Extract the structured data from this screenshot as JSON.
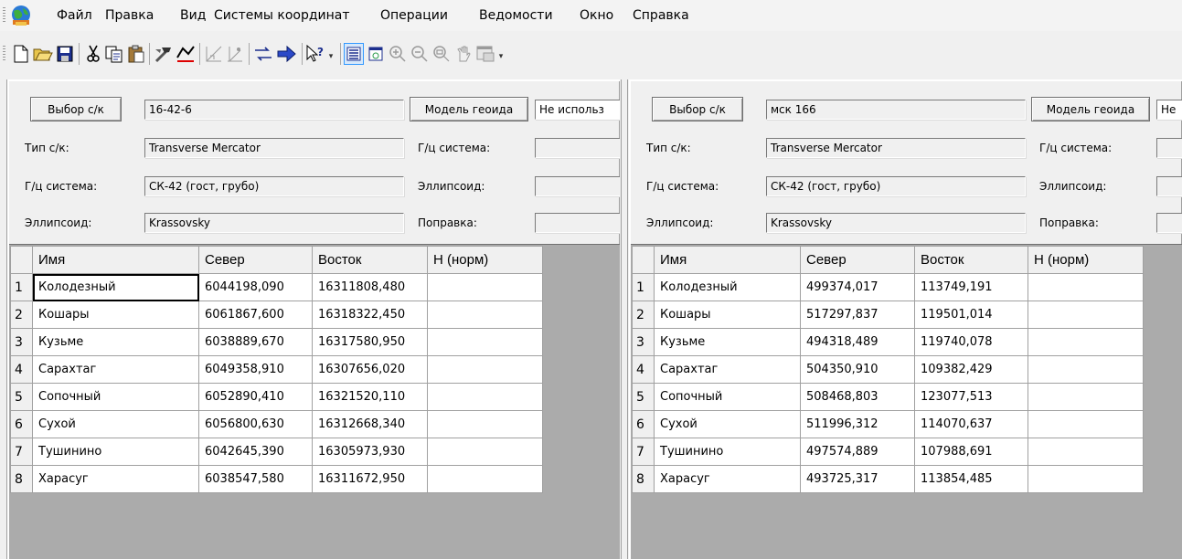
{
  "menu": [
    "Файл",
    "Правка",
    "Вид",
    "Системы координат",
    "Операции",
    "Ведомости",
    "Окно",
    "Справка"
  ],
  "toolbar": {
    "icons": [
      "new-file-icon",
      "open-folder-icon",
      "save-icon",
      "cut-icon",
      "copy-icon",
      "paste-icon",
      "tools-icon",
      "geodesic-icon",
      "axes-icon",
      "points-icon",
      "transform-icon",
      "context-help-icon",
      "list-view-icon",
      "form-view-icon",
      "zoom-in-icon",
      "zoom-out-icon",
      "zoom-extents-icon",
      "pan-icon",
      "window-icon"
    ],
    "active_color": "#3399ff"
  },
  "left": {
    "select_button": "Выбор с/к",
    "cs_name": "16-42-6",
    "geoid_button": "Модель геоида",
    "geoid_value": "Не использ",
    "type_label": "Тип с/к:",
    "type_value": "Transverse Mercator",
    "geo_label": "Г/ц система:",
    "geo_value": "СК-42 (гост, грубо)",
    "ellipsoid_label": "Эллипсоид:",
    "ellipsoid_value": "Krassovsky",
    "geo_label2": "Г/ц система:",
    "ellipsoid_label2": "Эллипсоид:",
    "correction_label": "Поправка:",
    "columns": [
      "Имя",
      "Север",
      "Восток",
      "H (норм)"
    ],
    "rows": [
      {
        "n": "1",
        "name": "Колодезный",
        "north": "6044198,090",
        "east": "16311808,480",
        "h": ""
      },
      {
        "n": "2",
        "name": "Кошары",
        "north": "6061867,600",
        "east": "16318322,450",
        "h": ""
      },
      {
        "n": "3",
        "name": "Кузьме",
        "north": "6038889,670",
        "east": "16317580,950",
        "h": ""
      },
      {
        "n": "4",
        "name": "Сарахтаг",
        "north": "6049358,910",
        "east": "16307656,020",
        "h": ""
      },
      {
        "n": "5",
        "name": "Сопочный",
        "north": "6052890,410",
        "east": "16321520,110",
        "h": ""
      },
      {
        "n": "6",
        "name": "Сухой",
        "north": "6056800,630",
        "east": "16312668,340",
        "h": ""
      },
      {
        "n": "7",
        "name": "Тушинино",
        "north": "6042645,390",
        "east": "16305973,930",
        "h": ""
      },
      {
        "n": "8",
        "name": "Харасуг",
        "north": "6038547,580",
        "east": "16311672,950",
        "h": ""
      }
    ]
  },
  "right": {
    "select_button": "Выбор с/к",
    "cs_name": "мск 166",
    "geoid_button": "Модель геоида",
    "geoid_value": "Не",
    "type_label": "Тип с/к:",
    "type_value": "Transverse Mercator",
    "geo_label": "Г/ц система:",
    "geo_value": "СК-42 (гост, грубо)",
    "ellipsoid_label": "Эллипсоид:",
    "ellipsoid_value": "Krassovsky",
    "geo_label2": "Г/ц система:",
    "ellipsoid_label2": "Эллипсоид:",
    "correction_label": "Поправка:",
    "columns": [
      "Имя",
      "Север",
      "Восток",
      "H (норм)"
    ],
    "rows": [
      {
        "n": "1",
        "name": "Колодезный",
        "north": "499374,017",
        "east": "113749,191",
        "h": ""
      },
      {
        "n": "2",
        "name": "Кошары",
        "north": "517297,837",
        "east": "119501,014",
        "h": ""
      },
      {
        "n": "3",
        "name": "Кузьме",
        "north": "494318,489",
        "east": "119740,078",
        "h": ""
      },
      {
        "n": "4",
        "name": "Сарахтаг",
        "north": "504350,910",
        "east": "109382,429",
        "h": ""
      },
      {
        "n": "5",
        "name": "Сопочный",
        "north": "508468,803",
        "east": "123077,513",
        "h": ""
      },
      {
        "n": "6",
        "name": "Сухой",
        "north": "511996,312",
        "east": "114070,637",
        "h": ""
      },
      {
        "n": "7",
        "name": "Тушинино",
        "north": "497574,889",
        "east": "107988,691",
        "h": ""
      },
      {
        "n": "8",
        "name": "Харасуг",
        "north": "493725,317",
        "east": "113854,485",
        "h": ""
      }
    ]
  }
}
